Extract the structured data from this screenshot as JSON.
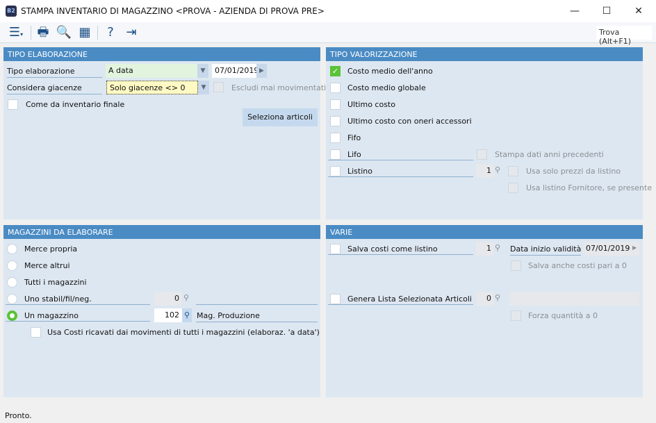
{
  "window": {
    "title": "STAMPA INVENTARIO DI MAGAZZINO <PROVA - AZIENDA DI PROVA PRE>",
    "logo": "B2",
    "minimize": "—",
    "maximize": "☐",
    "close": "✕"
  },
  "toolbar": {
    "icons": [
      "menu-icon",
      "print-icon",
      "print-preview-icon",
      "calendar-icon",
      "help-icon",
      "exit-icon"
    ],
    "find": "Trova (Alt+F1)"
  },
  "tipo_elaborazione": {
    "header": "TIPO ELABORAZIONE",
    "tipo_label": "Tipo elaborazione",
    "tipo_value": "A data",
    "date": "07/01/2019",
    "giacenze_label": "Considera giacenze",
    "giacenze_value": "Solo giacenze <> 0",
    "escludi": "Escludi mai movimentati",
    "come_inventario": "Come da inventario finale",
    "seleziona": "Seleziona articoli"
  },
  "tipo_valorizzazione": {
    "header": "TIPO VALORIZZAZIONE",
    "options": [
      {
        "label": "Costo medio dell'anno",
        "checked": true
      },
      {
        "label": "Costo medio globale",
        "checked": false
      },
      {
        "label": "Ultimo costo",
        "checked": false
      },
      {
        "label": "Ultimo costo con oneri accessori",
        "checked": false
      },
      {
        "label": "Fifo",
        "checked": false
      },
      {
        "label": "Lifo",
        "checked": false
      },
      {
        "label": "Listino",
        "checked": false
      }
    ],
    "stampa_anni": "Stampa dati anni precedenti",
    "listino_num": "1",
    "usa_solo_prezzi": "Usa solo prezzi da listino",
    "usa_fornitore": "Usa listino Fornitore, se presente"
  },
  "magazzini": {
    "header": "MAGAZZINI DA ELABORARE",
    "options": [
      {
        "label": "Merce propria",
        "selected": false
      },
      {
        "label": "Merce altrui",
        "selected": false
      },
      {
        "label": "Tutti i magazzini",
        "selected": false
      },
      {
        "label": "Uno stabil/fil/neg.",
        "selected": false
      },
      {
        "label": "Un magazzino",
        "selected": true
      }
    ],
    "stabil_value": "0",
    "mag_value": "102",
    "mag_desc": "Mag. Produzione",
    "usa_costi": "Usa Costi ricavati dai movimenti di tutti i magazzini (elaboraz. 'a data')"
  },
  "varie": {
    "header": "VARIE",
    "salva_costi": "Salva costi come listino",
    "salva_num": "1",
    "data_label": "Data inizio validità",
    "data_value": "07/01/2019",
    "salva_zero": "Salva anche costi pari a 0",
    "genera": "Genera Lista Selezionata Articoli",
    "genera_num": "0",
    "forza": "Forza quantità a 0"
  },
  "status": "Pronto.",
  "colors": {
    "header": "#4a8bc4",
    "panel": "#dde7f1",
    "check": "#5bc236"
  }
}
